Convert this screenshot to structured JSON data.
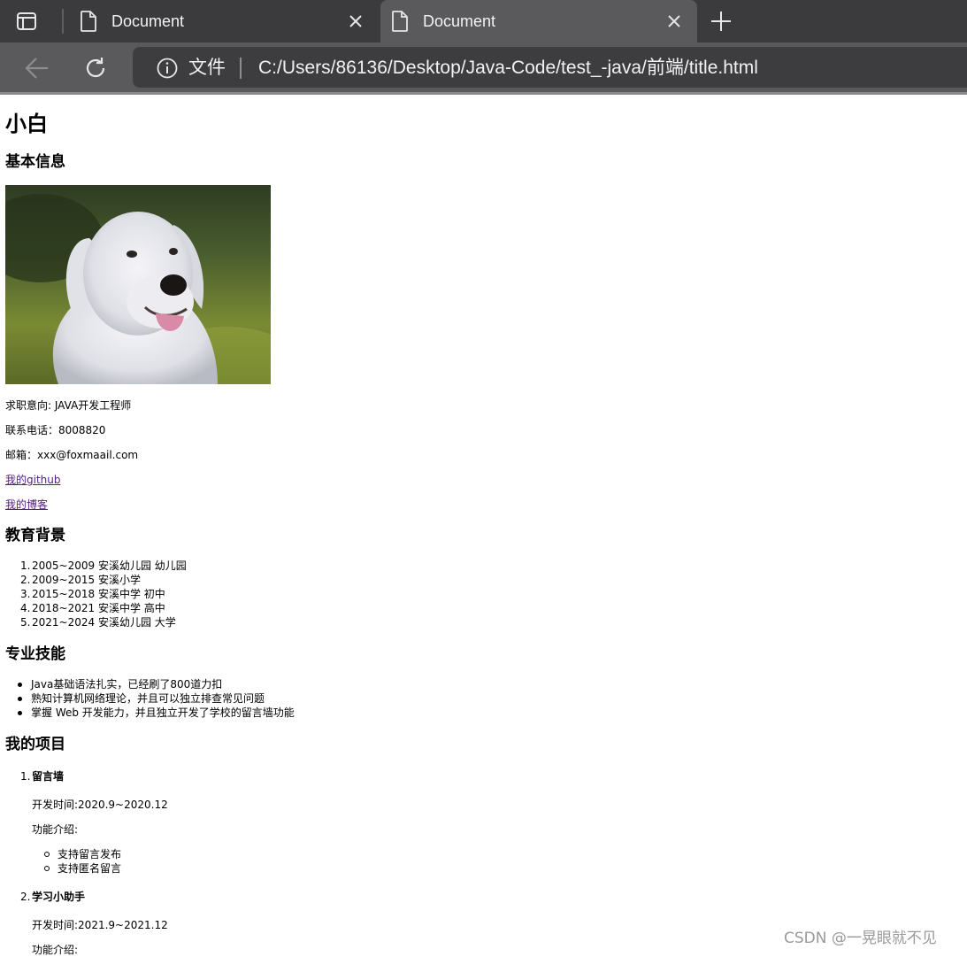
{
  "browser": {
    "tabs": [
      {
        "title": "Document",
        "active": false
      },
      {
        "title": "Document",
        "active": true
      }
    ],
    "address": {
      "scheme_label": "文件",
      "url": "C:/Users/86136/Desktop/Java-Code/test_-java/前端/title.html"
    },
    "icons": {
      "tab_actions": "tab-actions-icon",
      "page": "page-icon",
      "close": "close-icon",
      "new_tab": "plus-icon",
      "back": "back-arrow-icon",
      "reload": "reload-icon",
      "info": "info-icon"
    }
  },
  "page": {
    "name": "小白",
    "basic_heading": "基本信息",
    "job_intention": "求职意向: JAVA开发工程师",
    "phone": "联系电话：8008820",
    "email": "邮箱：xxx@foxmaail.com",
    "github_link": "我的github",
    "blog_link": "我的博客",
    "education_heading": "教育背景",
    "education": [
      "2005~2009 安溪幼儿园 幼儿园",
      "2009~2015 安溪小学",
      "2015~2018 安溪中学 初中",
      "2018~2021 安溪中学 高中",
      "2021~2024 安溪幼儿园 大学"
    ],
    "skills_heading": "专业技能",
    "skills": [
      "Java基础语法扎实，已经刷了800道力扣",
      "熟知计算机网络理论，并且可以独立排查常见问题",
      "掌握 Web 开发能力，并且独立开发了学校的留言墙功能"
    ],
    "projects_heading": "我的项目",
    "projects": [
      {
        "title": "留言墙",
        "dev_time": "开发时间:2020.9~2020.12",
        "intro_label": "功能介绍:",
        "features": [
          "支持留言发布",
          "支持匿名留言"
        ]
      },
      {
        "title": "学习小助手",
        "dev_time": "开发时间:2021.9~2021.12",
        "intro_label": "功能介绍:"
      }
    ]
  },
  "watermark": "CSDN @一晃眼就不见"
}
